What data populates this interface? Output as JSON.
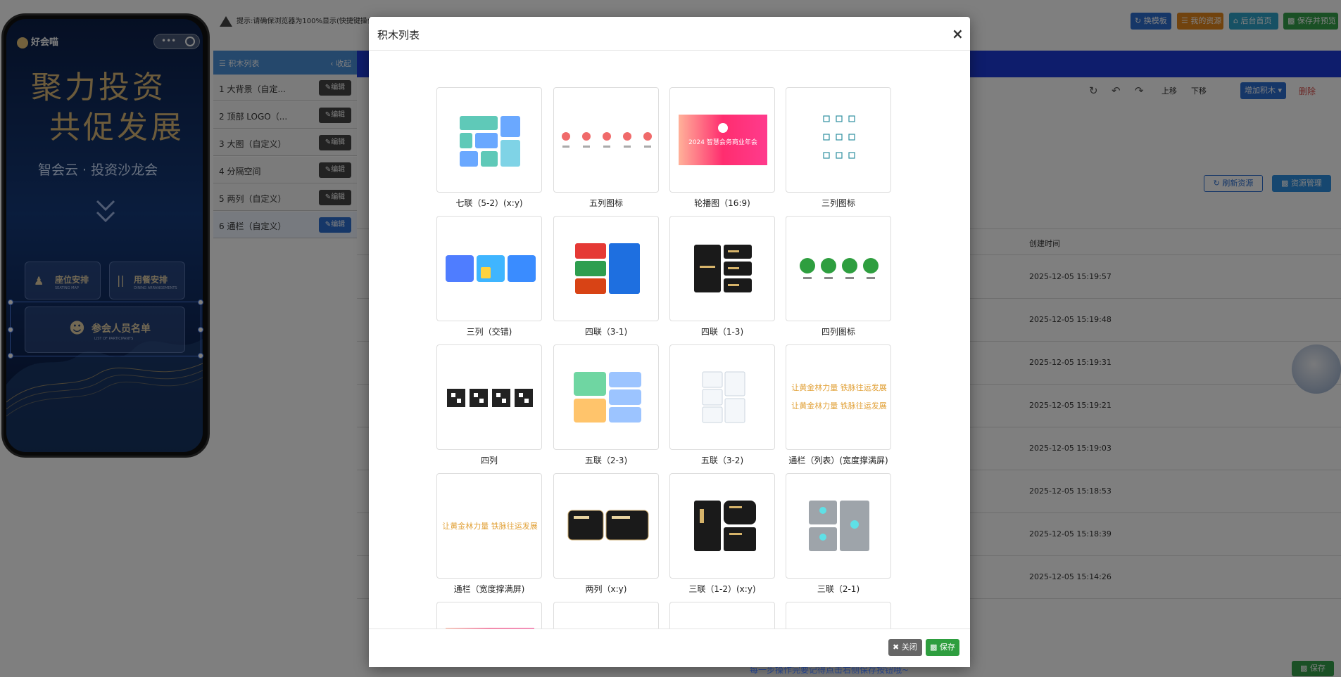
{
  "topbar": {
    "hint": "提示:请确保浏览器为100%显示(快捷键操作:C",
    "buttons": [
      {
        "label": "换模板",
        "color": "#2d6fd0"
      },
      {
        "label": "我的资源",
        "color": "#e2861d"
      },
      {
        "label": "后台首页",
        "color": "#2ea3c8"
      },
      {
        "label": "保存并预览",
        "color": "#34a04a"
      }
    ]
  },
  "phone": {
    "brand": "好会喵",
    "slogan_line1": "聚力投资",
    "slogan_line2": "共促发展",
    "subtitle": "智会云 · 投资沙龙会",
    "btn_seat": {
      "title": "座位安排",
      "sub": "SEATING MAP"
    },
    "btn_dining": {
      "title": "用餐安排",
      "sub": "DINING ARRANGEMENTS"
    },
    "btn_list": {
      "title": "参会人员名单",
      "sub": "LIST OF PARTICIPANTS"
    }
  },
  "blocks": {
    "header": "积木列表",
    "collapse": "收起",
    "edit_label": "编辑",
    "items": [
      {
        "label": "1 大背景（自定..."
      },
      {
        "label": "2 顶部 LOGO（..."
      },
      {
        "label": "3 大图（自定义）"
      },
      {
        "label": "4 分隔空间"
      },
      {
        "label": "5 两列（自定义）"
      },
      {
        "label": "6 通栏（自定义）"
      }
    ]
  },
  "toolbar": {
    "up": "上移",
    "down": "下移",
    "add_block": "增加积木",
    "delete": "删除"
  },
  "resources": {
    "refresh": "刷新资源",
    "manage": "资源管理",
    "col_created": "创建时间",
    "dates": [
      "2025-12-05 15:19:57",
      "2025-12-05 15:19:48",
      "2025-12-05 15:19:31",
      "2025-12-05 15:19:21",
      "2025-12-05 15:19:03",
      "2025-12-05 15:18:53",
      "2025-12-05 15:18:39",
      "2025-12-05 15:14:26"
    ]
  },
  "modal": {
    "title": "积木列表",
    "close_label": "关闭",
    "save_label": "保存",
    "carousel_text": "2024 智慧会务商业年会",
    "scroll_banner_text": "让黄金林力量 铁脉往运发展",
    "cards": [
      {
        "label": "七联（5-2）(x:y)"
      },
      {
        "label": "五列图标"
      },
      {
        "label": "轮播图（16:9)"
      },
      {
        "label": "三列图标"
      },
      {
        "label": "三列（交错)"
      },
      {
        "label": "四联（3-1)"
      },
      {
        "label": "四联（1-3)"
      },
      {
        "label": "四列图标"
      },
      {
        "label": "四列"
      },
      {
        "label": "五联（2-3)"
      },
      {
        "label": "五联（3-2)"
      },
      {
        "label": "通栏（列表）(宽度撑满屏)"
      },
      {
        "label": "通栏（宽度撑满屏)"
      },
      {
        "label": "两列（x:y)"
      },
      {
        "label": "三联（1-2）(x:y)"
      },
      {
        "label": "三联（2-1)"
      }
    ]
  },
  "page_save": "保存",
  "bottom_tip": "每一步操作完要记得点击右侧保存按钮哦~"
}
